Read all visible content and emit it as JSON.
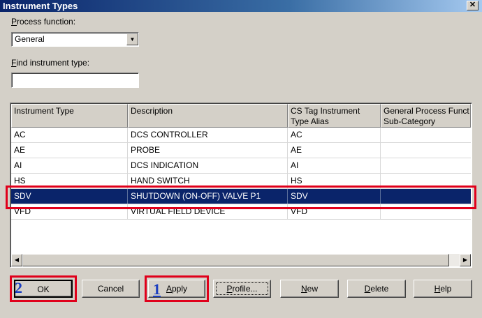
{
  "window": {
    "title": "Instrument Types",
    "close_glyph": "✕"
  },
  "process_function": {
    "label_prefix": "",
    "label_key": "P",
    "label_rest": "rocess function:",
    "selected": "General"
  },
  "find": {
    "label_key": "F",
    "label_rest": "ind instrument type:",
    "value": ""
  },
  "table": {
    "columns": [
      "Instrument Type",
      "Description",
      "CS Tag Instrument Type Alias",
      "General Process Function Sub-Category"
    ],
    "column_lines": [
      [
        "Instrument Type"
      ],
      [
        "Description"
      ],
      [
        "CS Tag Instrument",
        "Type Alias"
      ],
      [
        "General Process Funct",
        "Sub-Category"
      ]
    ],
    "rows": [
      {
        "type": "AC",
        "description": "DCS CONTROLLER",
        "alias": "AC",
        "subcat": ""
      },
      {
        "type": "AE",
        "description": "PROBE",
        "alias": "AE",
        "subcat": ""
      },
      {
        "type": "AI",
        "description": "DCS INDICATION",
        "alias": "AI",
        "subcat": ""
      },
      {
        "type": "HS",
        "description": "HAND SWITCH",
        "alias": "HS",
        "subcat": ""
      },
      {
        "type": "SDV",
        "description": "SHUTDOWN  (ON-OFF) VALVE P1",
        "alias": "SDV",
        "subcat": ""
      },
      {
        "type": "VFD",
        "description": "VIRTUAL FIELD DEVICE",
        "alias": "VFD",
        "subcat": ""
      }
    ],
    "selected_row": 4
  },
  "buttons": {
    "ok": "OK",
    "cancel": "Cancel",
    "apply_key": "A",
    "apply_rest": "pply",
    "profile_key": "P",
    "profile_rest": "rofile...",
    "new_key": "N",
    "new_rest": "ew",
    "delete_key": "D",
    "delete_rest": "elete",
    "help_key": "H",
    "help_rest": "elp"
  },
  "annotations": {
    "step1": "1",
    "step2": "2"
  },
  "colors": {
    "selection": "#0a246a",
    "highlight_box": "#e0001b",
    "step_number": "#1a3dbf"
  }
}
